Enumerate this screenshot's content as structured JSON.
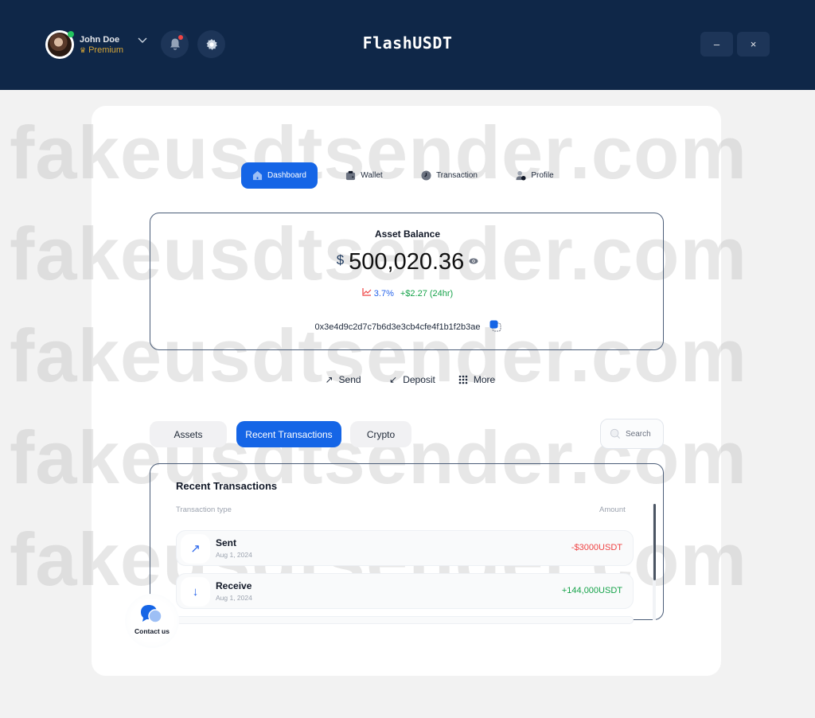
{
  "header": {
    "user": {
      "name": "John Doe",
      "tier": "Premium",
      "online": true
    },
    "app_title": "FlashUSDT",
    "icons": {
      "dropdown": "chevron-down-icon",
      "notifications": "bell-icon",
      "settings": "gear-icon"
    },
    "window_controls": {
      "minimize": "–",
      "close": "×"
    }
  },
  "watermark": "fakeusdtsender.com",
  "nav": {
    "tabs": [
      {
        "label": "Dashboard",
        "icon": "home-icon",
        "active": true
      },
      {
        "label": "Wallet",
        "icon": "wallet-icon",
        "active": false
      },
      {
        "label": "Transaction",
        "icon": "clock-icon",
        "active": false
      },
      {
        "label": "Profile",
        "icon": "user-icon",
        "active": false
      }
    ]
  },
  "balance": {
    "title": "Asset Balance",
    "currency": "$",
    "amount": "500,020.36",
    "change_percent": "3.7%",
    "change_value": "+$2.27 (24hr)",
    "address": "0x3e4d9c2d7c7b6d3e3cb4cfe4f1b1f2b3ae"
  },
  "actions": [
    {
      "label": "Send",
      "icon": "arrow-up-right-icon",
      "glyph": "↗"
    },
    {
      "label": "Deposit",
      "icon": "arrow-down-left-icon",
      "glyph": "↙"
    },
    {
      "label": "More",
      "icon": "grid-icon",
      "glyph": "⠿"
    }
  ],
  "section_tabs": [
    {
      "label": "Assets",
      "active": false
    },
    {
      "label": "Recent Transactions",
      "active": true
    },
    {
      "label": "Crypto",
      "active": false
    }
  ],
  "search": {
    "placeholder": "Search"
  },
  "transactions": {
    "title": "Recent Transactions",
    "columns": {
      "type": "Transaction type",
      "amount": "Amount"
    },
    "rows": [
      {
        "type": "Sent",
        "date": "Aug 1, 2024",
        "amount": "-$3000USDT",
        "direction": "out",
        "glyph": "↗"
      },
      {
        "type": "Receive",
        "date": "Aug 1, 2024",
        "amount": "+144,000USDT",
        "direction": "in",
        "glyph": "↓"
      }
    ]
  },
  "contact": {
    "label": "Contact us"
  },
  "colors": {
    "header_bg": "#0f2748",
    "accent": "#1565e6",
    "negative": "#ef4444",
    "positive": "#16a34a",
    "premium": "#d4a437"
  }
}
